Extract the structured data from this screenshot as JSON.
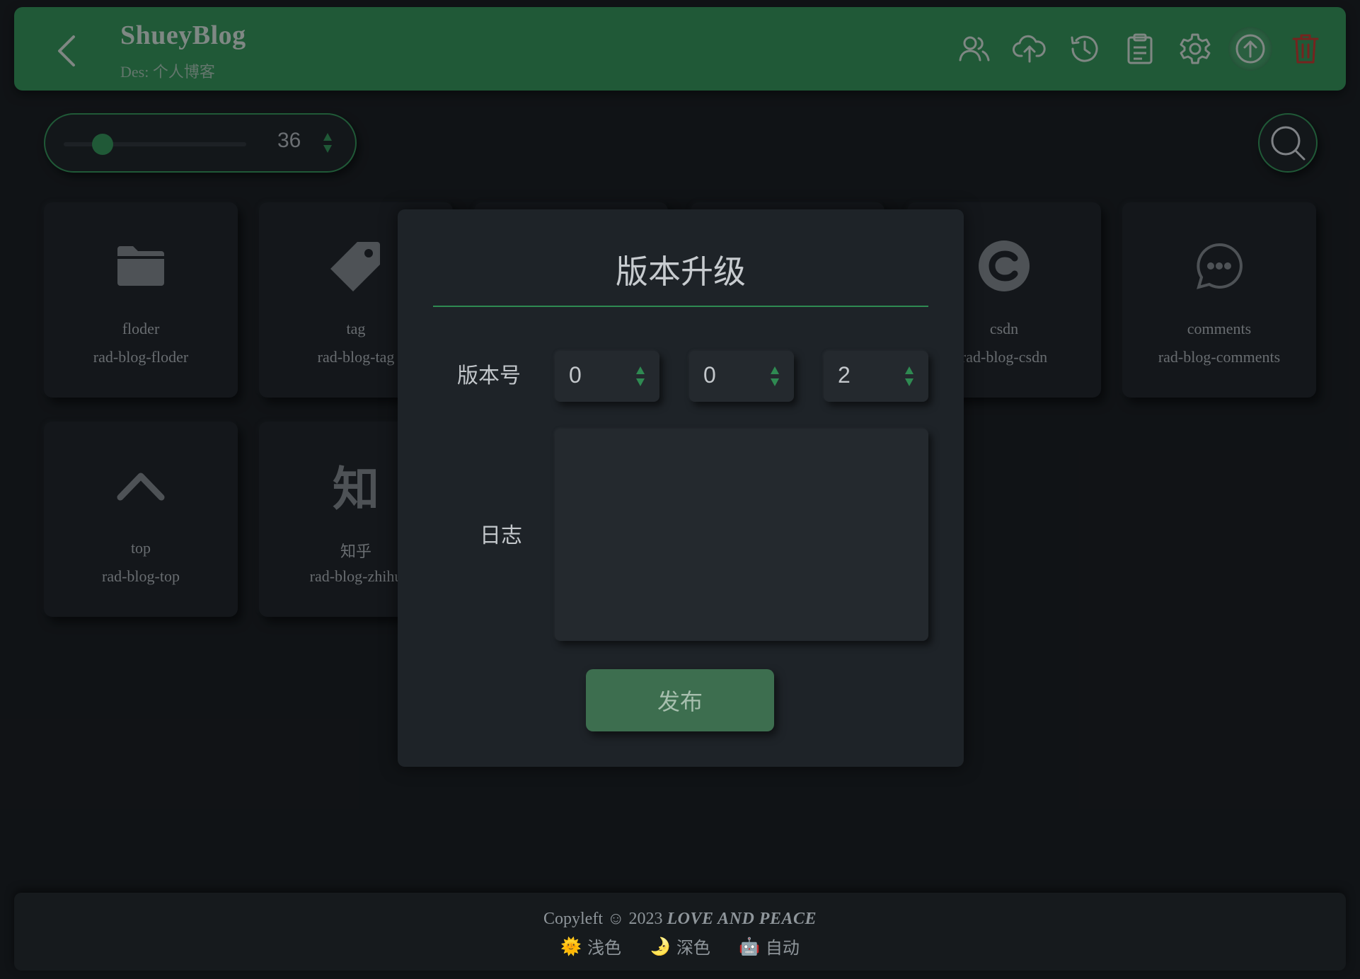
{
  "header": {
    "title": "ShueyBlog",
    "description": "Des: 个人博客",
    "icons": [
      "back-icon",
      "users-icon",
      "cloud-upload-icon",
      "history-icon",
      "clipboard-icon",
      "gear-icon",
      "upload-circle-icon",
      "trash-icon"
    ]
  },
  "toolbar": {
    "size_value": "36",
    "size_fraction": 0.15
  },
  "cards": [
    {
      "name": "floder",
      "id": "rad-blog-floder",
      "icon": "folder-icon"
    },
    {
      "name": "tag",
      "id": "rad-blog-tag",
      "icon": "tag-icon"
    },
    {
      "name": "csdn",
      "id": "rad-blog-csdn",
      "icon": "csdn-icon"
    },
    {
      "name": "comments",
      "id": "rad-blog-comments",
      "icon": "comments-icon"
    },
    {
      "name": "top",
      "id": "rad-blog-top",
      "icon": "chevron-up-icon"
    },
    {
      "name": "知乎",
      "id": "rad-blog-zhihu",
      "icon_text": "知",
      "icon": "zhihu-icon"
    }
  ],
  "dialog": {
    "title": "版本升级",
    "version_label": "版本号",
    "version": {
      "major": "0",
      "minor": "0",
      "patch": "2"
    },
    "log_label": "日志",
    "log_value": "",
    "publish_label": "发布"
  },
  "footer": {
    "copyright": "Copyleft ☺ 2023",
    "motto": "LOVE AND PEACE",
    "themes": [
      {
        "icon": "🌞",
        "label": "浅色"
      },
      {
        "icon": "🌛",
        "label": "深色"
      },
      {
        "icon": "🤖",
        "label": "自动"
      }
    ]
  },
  "colors": {
    "accent": "#2f8a52",
    "background": "#16191c",
    "danger": "#c0392b"
  }
}
